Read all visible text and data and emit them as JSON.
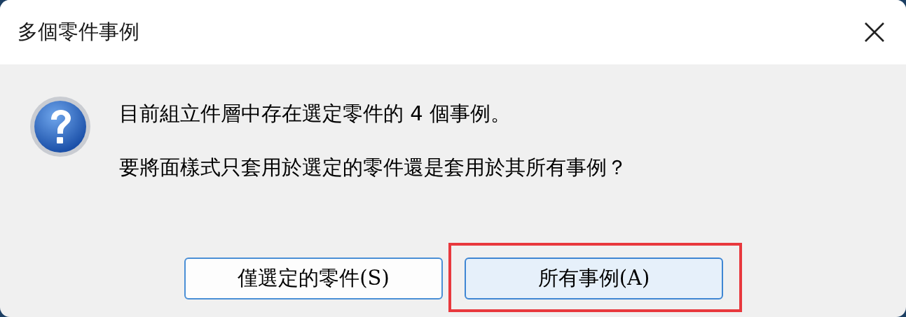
{
  "window": {
    "title": "多個零件事例"
  },
  "message": {
    "lines": [
      "目前組立件層中存在選定零件的 4 個事例。",
      "要將面樣式只套用於選定的零件還是套用於其所有事例？"
    ]
  },
  "buttons": [
    {
      "label": "僅選定的零件(S)",
      "default": false,
      "highlighted": false
    },
    {
      "label": "所有事例(A)",
      "default": true,
      "highlighted": true
    }
  ]
}
